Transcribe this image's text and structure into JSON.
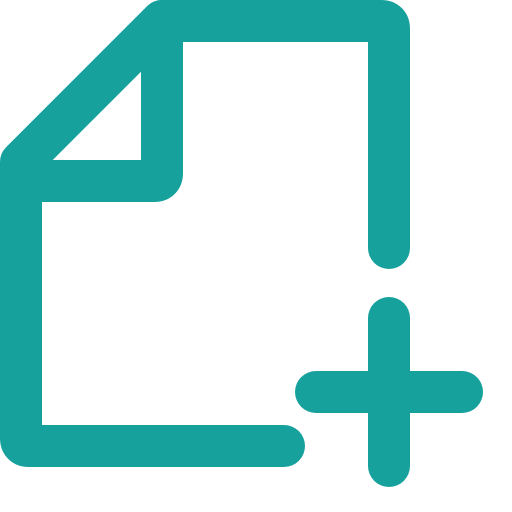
{
  "icon": {
    "name": "file-add-icon",
    "color": "#17A19C",
    "parts": [
      "document-outline",
      "folded-corner",
      "plus-sign"
    ]
  }
}
